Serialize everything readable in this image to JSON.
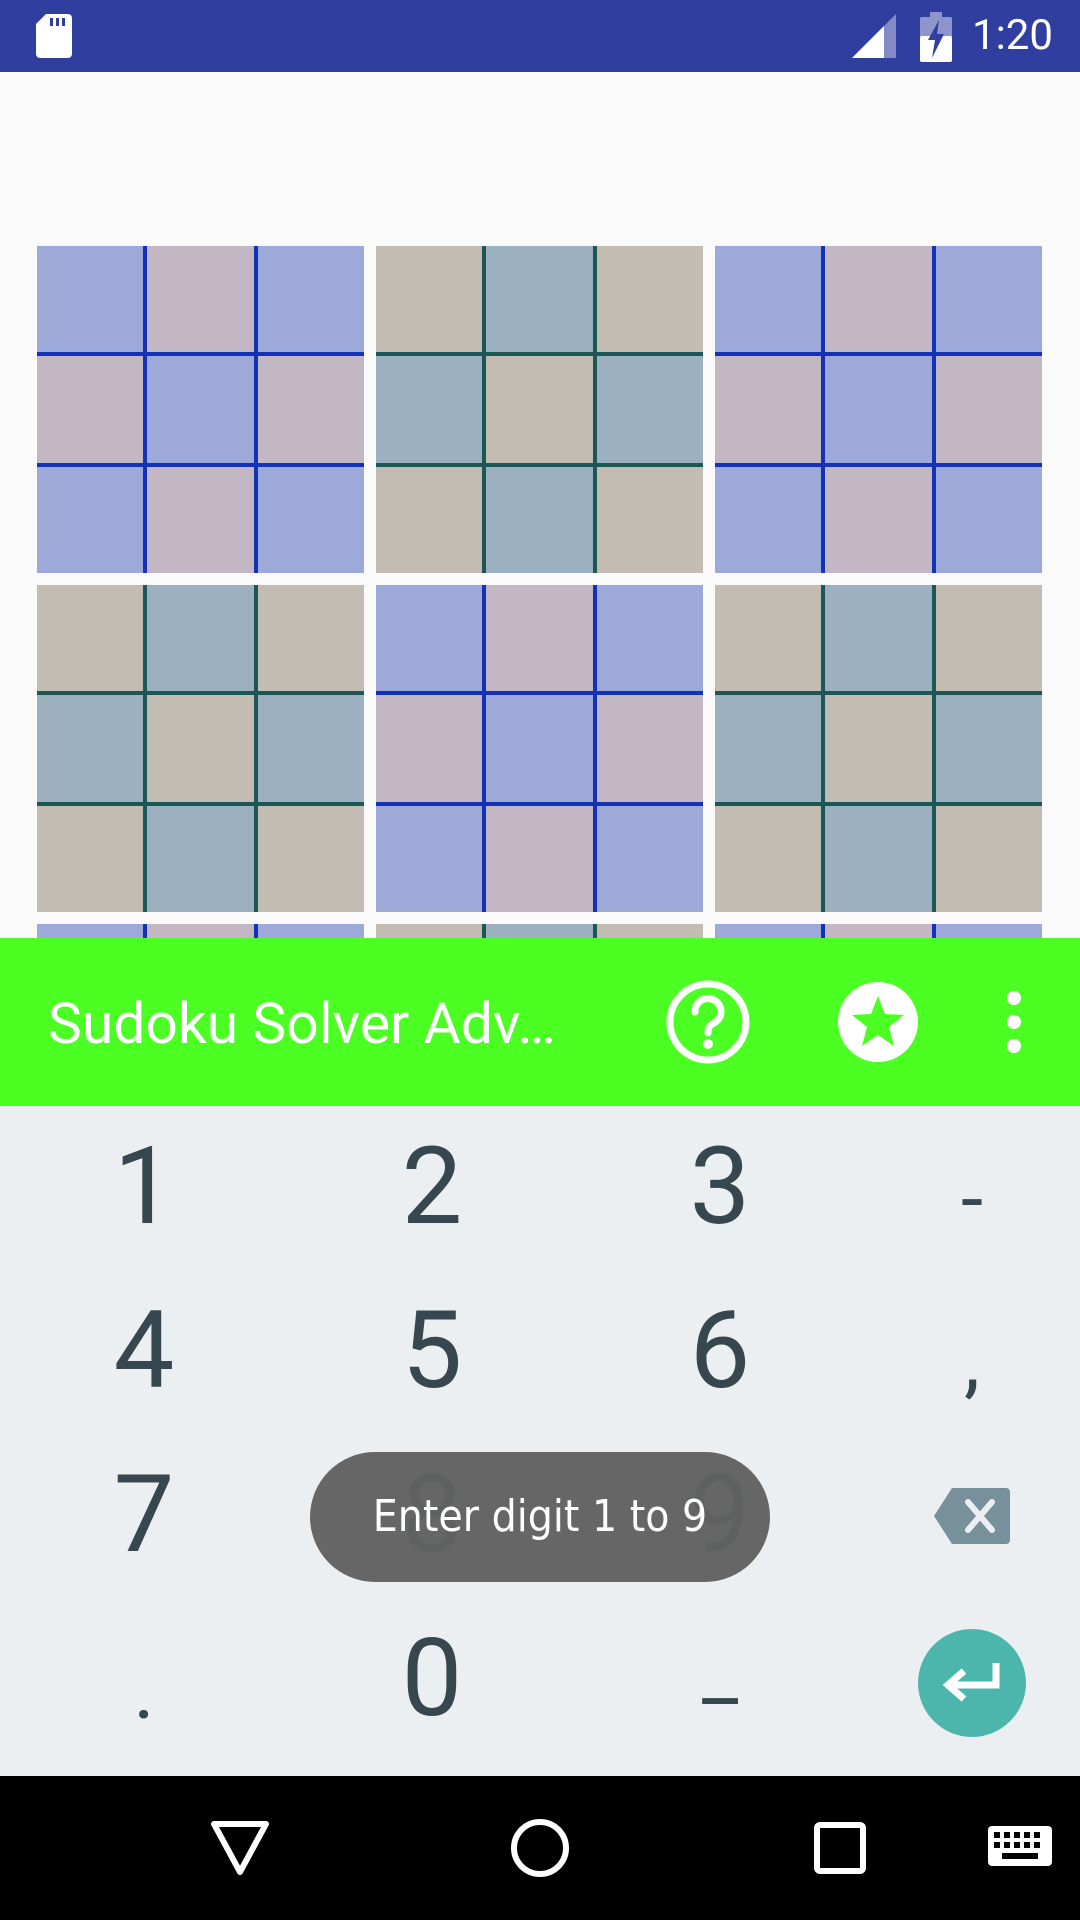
{
  "status_bar": {
    "time": "1:20",
    "icons": [
      "sd-card-icon",
      "cell-signal-icon",
      "battery-charging-icon"
    ]
  },
  "toolbar": {
    "title": "Sudoku Solver Adv…",
    "background_color": "#4cff22",
    "actions": [
      "help-icon",
      "star-icon",
      "more-vert-icon"
    ]
  },
  "keyboard": {
    "rows": [
      [
        "1",
        "2",
        "3",
        "-"
      ],
      [
        "4",
        "5",
        "6",
        ","
      ],
      [
        "7",
        "8",
        "9",
        "backspace"
      ],
      [
        ".",
        "0",
        "_",
        "enter"
      ]
    ],
    "enter_color": "#4db6ac"
  },
  "toast": {
    "message": "Enter digit 1 to 9"
  },
  "grid_colors": {
    "blue_block_lines": "#1432b8",
    "blue_cell_a": "#9daad9",
    "blue_cell_b": "#c2b7c2",
    "green_block_lines": "#1c5757",
    "green_cell_a": "#c3bcb2",
    "green_cell_b": "#9cb0c0"
  }
}
